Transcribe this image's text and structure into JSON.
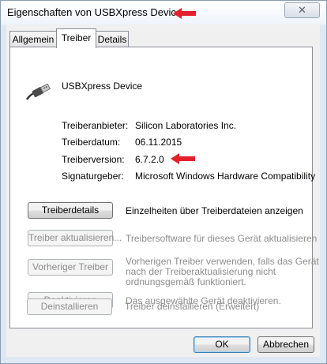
{
  "window": {
    "title": "Eigenschaften von USBXpress Device",
    "close_label": "✕"
  },
  "tabs": [
    {
      "label": "Allgemein",
      "active": false
    },
    {
      "label": "Treiber",
      "active": true
    },
    {
      "label": "Details",
      "active": false
    }
  ],
  "device": {
    "name": "USBXpress Device",
    "icon": "usb-cable-icon"
  },
  "driver_info": {
    "provider_label": "Treiberanbieter:",
    "provider_value": "Silicon Laboratories Inc.",
    "date_label": "Treiberdatum:",
    "date_value": "06.11.2015",
    "version_label": "Treiberversion:",
    "version_value": "6.7.2.0",
    "signer_label": "Signaturgeber:",
    "signer_value": "Microsoft Windows Hardware Compatibility"
  },
  "actions": {
    "details_label": "Treiberdetails",
    "details_desc": "Einzelheiten über Treiberdateien anzeigen",
    "update_label": "Treiber aktualisieren...",
    "update_desc": "Treibersoftware für dieses Gerät aktualisieren",
    "rollback_label": "Vorheriger Treiber",
    "rollback_desc_1": "Vorherigen Treiber verwenden, falls das Gerät",
    "rollback_desc_2": "nach der Treiberaktualisierung nicht",
    "rollback_desc_3": "ordnungsgemäß funktioniert.",
    "disable_label": "Deaktivieren",
    "disable_desc": "Das ausgewählte Gerät deaktivieren.",
    "uninstall_label": "Deinstallieren",
    "uninstall_desc": "Treiber deinstallieren (Erweitert)"
  },
  "footer": {
    "ok_label": "OK",
    "cancel_label": "Abbrechen"
  },
  "colors": {
    "annotation_arrow": "#e3202b",
    "disabled_text": "#8c8c8c"
  }
}
